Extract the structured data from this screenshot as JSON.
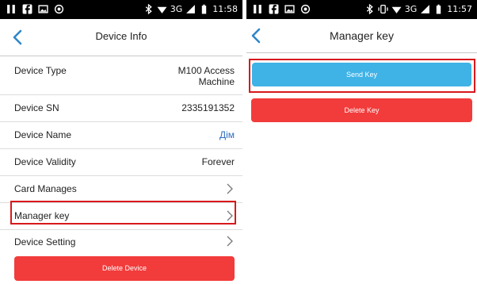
{
  "left_screen": {
    "status_bar": {
      "time": "11:58",
      "network": "3G"
    },
    "header": {
      "title": "Device Info"
    },
    "rows": [
      {
        "label": "Device Type",
        "value": "M100 Access Machine"
      },
      {
        "label": "Device SN",
        "value": "2335191352"
      },
      {
        "label": "Device Name",
        "value": "Дім"
      },
      {
        "label": "Device Validity",
        "value": "Forever"
      },
      {
        "label": "Card Manages"
      },
      {
        "label": "Manager key"
      },
      {
        "label": "Device Setting"
      }
    ],
    "delete_button": "Delete Device"
  },
  "right_screen": {
    "status_bar": {
      "time": "11:57",
      "network": "3G"
    },
    "header": {
      "title": "Manager key"
    },
    "send_button": "Send Key",
    "delete_button": "Delete Key"
  },
  "colors": {
    "accent_blue": "#3fb2e6",
    "danger_red": "#f23b3b",
    "highlight_red": "#d8191c",
    "link_blue": "#2f6fbf"
  }
}
